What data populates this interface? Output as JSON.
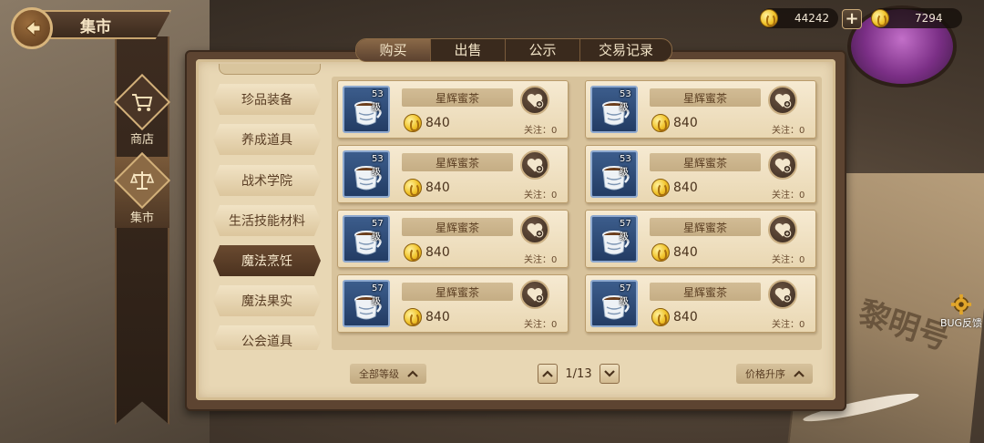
{
  "header": {
    "title": "集市"
  },
  "side_nav": [
    {
      "label": "商店",
      "icon": "cart-icon",
      "active": false
    },
    {
      "label": "集市",
      "icon": "scales-icon",
      "active": true
    }
  ],
  "currency": [
    {
      "icon": "gold-coin-icon",
      "amount": "44242"
    },
    {
      "icon": "gold-coin-icon",
      "amount": "7294"
    }
  ],
  "tabs": [
    {
      "label": "购买",
      "active": true
    },
    {
      "label": "出售",
      "active": false
    },
    {
      "label": "公示",
      "active": false
    },
    {
      "label": "交易记录",
      "active": false
    }
  ],
  "categories": [
    {
      "label": "珍品装备",
      "active": false
    },
    {
      "label": "养成道具",
      "active": false
    },
    {
      "label": "战术学院",
      "active": false
    },
    {
      "label": "生活技能材料",
      "active": false
    },
    {
      "label": "魔法烹饪",
      "active": true
    },
    {
      "label": "魔法果实",
      "active": false
    },
    {
      "label": "公会道具",
      "active": false
    }
  ],
  "items": [
    {
      "level": "53级",
      "name": "星辉蜜茶",
      "price": "840",
      "follow": "关注：0"
    },
    {
      "level": "53级",
      "name": "星辉蜜茶",
      "price": "840",
      "follow": "关注：0"
    },
    {
      "level": "53级",
      "name": "星辉蜜茶",
      "price": "840",
      "follow": "关注：0"
    },
    {
      "level": "53级",
      "name": "星辉蜜茶",
      "price": "840",
      "follow": "关注：0"
    },
    {
      "level": "57级",
      "name": "星辉蜜茶",
      "price": "840",
      "follow": "关注：0"
    },
    {
      "level": "57级",
      "name": "星辉蜜茶",
      "price": "840",
      "follow": "关注：0"
    },
    {
      "level": "57级",
      "name": "星辉蜜茶",
      "price": "840",
      "follow": "关注：0"
    },
    {
      "level": "57级",
      "name": "星辉蜜茶",
      "price": "840",
      "follow": "关注：0"
    }
  ],
  "filters": {
    "level_filter": "全部等级",
    "sort": "价格升序"
  },
  "pagination": {
    "text": "1/13"
  },
  "bug_feedback": {
    "label": "BUG反馈"
  },
  "background": {
    "book_text": "黎明号"
  },
  "colors": {
    "accent_gold": "#f0c127",
    "panel_brown": "#5d4431",
    "parchment": "#e8d7b4"
  }
}
